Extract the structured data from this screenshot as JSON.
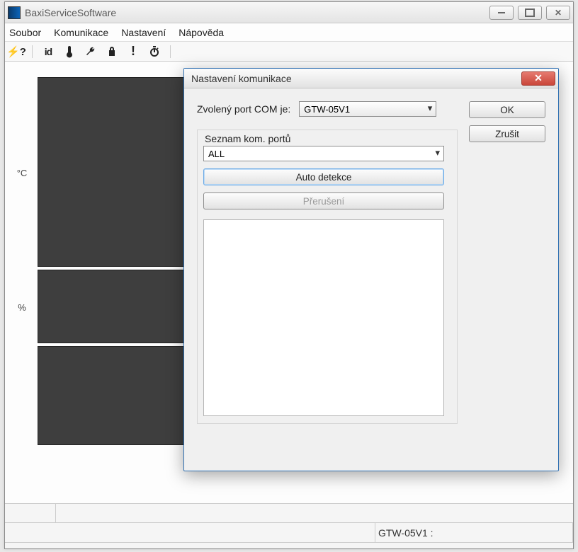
{
  "app": {
    "title": "BaxiServiceSoftware"
  },
  "menu": {
    "file": "Soubor",
    "comm": "Komunikace",
    "settings": "Nastavení",
    "help": "Nápověda"
  },
  "toolbar": {
    "icons": [
      "plug",
      "id",
      "thermometer",
      "wrench",
      "lock",
      "exclaim",
      "stopwatch"
    ]
  },
  "axis": {
    "unit_top": "°C",
    "unit_mid": "%"
  },
  "statusbar": {
    "port": "GTW-05V1 :"
  },
  "dialog": {
    "title": "Nastavení komunikace",
    "port_label": "Zvolený port COM je:",
    "port_value": "GTW-05V1",
    "ports_group_label": "Seznam kom. portů",
    "ports_list_value": "ALL",
    "auto_detect": "Auto detekce",
    "abort": "Přerušení",
    "ok": "OK",
    "cancel": "Zrušit"
  }
}
